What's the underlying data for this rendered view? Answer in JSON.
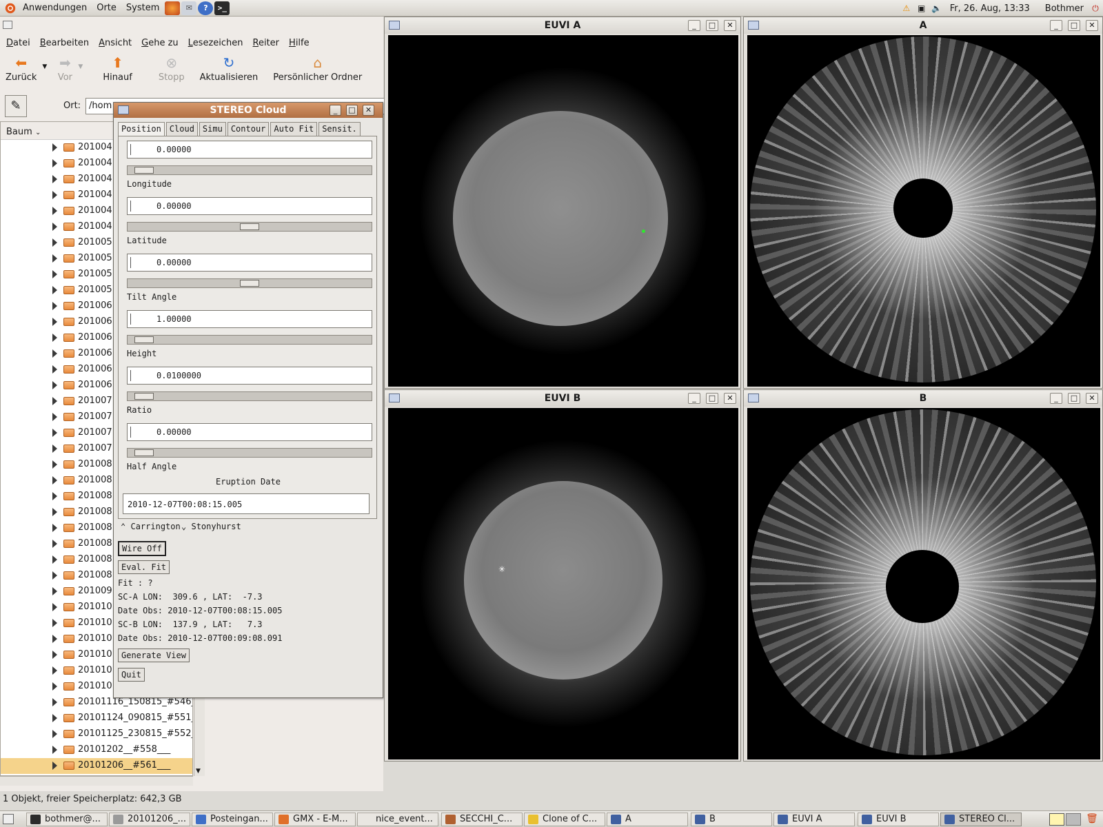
{
  "top_panel": {
    "menus": [
      "Anwendungen",
      "Orte",
      "System"
    ],
    "datetime": "Fr, 26. Aug, 13:33",
    "user": "Bothmer"
  },
  "file_manager": {
    "menu": [
      "Datei",
      "Bearbeiten",
      "Ansicht",
      "Gehe zu",
      "Lesezeichen",
      "Reiter",
      "Hilfe"
    ],
    "toolbar": {
      "back": "Zurück",
      "forward": "Vor",
      "up": "Hinauf",
      "stop": "Stopp",
      "reload": "Aktualisieren",
      "home": "Persönlicher Ordner"
    },
    "location_label": "Ort:",
    "location_value": "/hom",
    "tree_mode": "Baum",
    "tree_items": [
      "201004",
      "201004",
      "201004",
      "201004",
      "201004",
      "201004",
      "201005",
      "201005",
      "201005",
      "201005",
      "201006",
      "201006",
      "201006",
      "201006",
      "201006",
      "201006",
      "201007",
      "201007",
      "201007",
      "201007",
      "201008",
      "201008",
      "201008",
      "201008",
      "201008",
      "201008",
      "201008",
      "201008",
      "201009",
      "201010",
      "201010",
      "201010",
      "201010",
      "201010",
      "201010",
      "20101116_150815_#546_",
      "20101124_090815_#551_",
      "20101125_230815_#552_",
      "20101202__#558___",
      "20101206__#561___"
    ],
    "status": "1 Objekt, freier Speicherplatz: 642,3 GB"
  },
  "stereo_cloud": {
    "title": "STEREO Cloud",
    "tabs": [
      "Position",
      "Cloud",
      "Simu",
      "Contour",
      "Auto Fit",
      "Sensit."
    ],
    "fields": [
      {
        "label": "Longitude",
        "value": "0.00000",
        "slider": 0.03
      },
      {
        "label": "Latitude",
        "value": "0.00000",
        "slider": 0.5
      },
      {
        "label": "Tilt Angle",
        "value": "0.00000",
        "slider": 0.5
      },
      {
        "label": "Height",
        "value": "1.00000",
        "slider": 0.03
      },
      {
        "label": "Ratio",
        "value": "0.0100000",
        "slider": 0.03
      },
      {
        "label": "Half Angle",
        "value": "0.00000",
        "slider": 0.03
      }
    ],
    "eruption_label": "Eruption Date",
    "eruption_value": "2010-12-07T00:08:15.005",
    "radio": [
      "Carrington",
      "Stonyhurst"
    ],
    "wire_button": "Wire Off",
    "eval_button": "Eval. Fit",
    "fit_text": "Fit : ?",
    "sca_line": "SC-A LON:  309.6 , LAT:  -7.3",
    "sca_date": "Date Obs: 2010-12-07T00:08:15.005",
    "scb_line": "SC-B LON:  137.9 , LAT:   7.3",
    "scb_date": "Date Obs: 2010-12-07T00:09:08.091",
    "generate_button": "Generate View",
    "quit_button": "Quit"
  },
  "windows": {
    "euvi_a": "EUVI A",
    "a": "A",
    "euvi_b": "EUVI B",
    "b": "B"
  },
  "taskbar": [
    "bothmer@...",
    "20101206_...",
    "Posteingan...",
    "GMX - E-M...",
    "nice_event...",
    "SECCHI_C...",
    "Clone of C...",
    "A",
    "B",
    "EUVI A",
    "EUVI B",
    "STEREO Cl..."
  ]
}
